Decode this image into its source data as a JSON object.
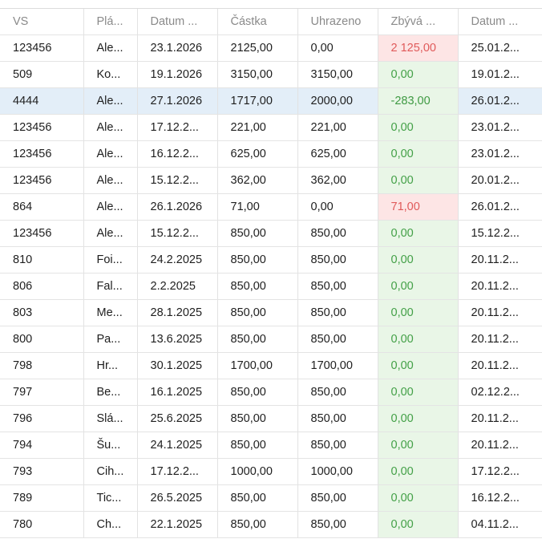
{
  "columns": [
    "VS",
    "Plá...",
    "Datum ...",
    "Částka",
    "Uhrazeno",
    "Zbývá ...",
    "Datum ..."
  ],
  "rows": [
    {
      "vs": "123456",
      "pla": "Ale...",
      "datum": "23.1.2026",
      "castka": "2125,00",
      "uhrazeno": "0,00",
      "zbyva": "2 125,00",
      "zbyva_status": "due",
      "datum2": "25.01.2..."
    },
    {
      "vs": "509",
      "pla": "Ko...",
      "datum": "19.1.2026",
      "castka": "3150,00",
      "uhrazeno": "3150,00",
      "zbyva": "0,00",
      "zbyva_status": "paid",
      "datum2": "19.01.2..."
    },
    {
      "vs": "4444",
      "pla": "Ale...",
      "datum": "27.1.2026",
      "castka": "1717,00",
      "uhrazeno": "2000,00",
      "zbyva": "-283,00",
      "zbyva_status": "overpaid",
      "datum2": "26.01.2...",
      "selected": true
    },
    {
      "vs": "123456",
      "pla": "Ale...",
      "datum": "17.12.2...",
      "castka": "221,00",
      "uhrazeno": "221,00",
      "zbyva": "0,00",
      "zbyva_status": "paid",
      "datum2": "23.01.2..."
    },
    {
      "vs": "123456",
      "pla": "Ale...",
      "datum": "16.12.2...",
      "castka": "625,00",
      "uhrazeno": "625,00",
      "zbyva": "0,00",
      "zbyva_status": "paid",
      "datum2": "23.01.2..."
    },
    {
      "vs": "123456",
      "pla": "Ale...",
      "datum": "15.12.2...",
      "castka": "362,00",
      "uhrazeno": "362,00",
      "zbyva": "0,00",
      "zbyva_status": "paid",
      "datum2": "20.01.2..."
    },
    {
      "vs": "864",
      "pla": "Ale...",
      "datum": "26.1.2026",
      "castka": "71,00",
      "uhrazeno": "0,00",
      "zbyva": "71,00",
      "zbyva_status": "due",
      "datum2": "26.01.2..."
    },
    {
      "vs": "123456",
      "pla": "Ale...",
      "datum": "15.12.2...",
      "castka": "850,00",
      "uhrazeno": "850,00",
      "zbyva": "0,00",
      "zbyva_status": "paid",
      "datum2": "15.12.2..."
    },
    {
      "vs": "810",
      "pla": "Foi...",
      "datum": "24.2.2025",
      "castka": "850,00",
      "uhrazeno": "850,00",
      "zbyva": "0,00",
      "zbyva_status": "paid",
      "datum2": "20.11.2..."
    },
    {
      "vs": "806",
      "pla": "Fal...",
      "datum": "2.2.2025",
      "castka": "850,00",
      "uhrazeno": "850,00",
      "zbyva": "0,00",
      "zbyva_status": "paid",
      "datum2": "20.11.2..."
    },
    {
      "vs": "803",
      "pla": "Me...",
      "datum": "28.1.2025",
      "castka": "850,00",
      "uhrazeno": "850,00",
      "zbyva": "0,00",
      "zbyva_status": "paid",
      "datum2": "20.11.2..."
    },
    {
      "vs": "800",
      "pla": "Pa...",
      "datum": "13.6.2025",
      "castka": "850,00",
      "uhrazeno": "850,00",
      "zbyva": "0,00",
      "zbyva_status": "paid",
      "datum2": "20.11.2..."
    },
    {
      "vs": "798",
      "pla": "Hr...",
      "datum": "30.1.2025",
      "castka": "1700,00",
      "uhrazeno": "1700,00",
      "zbyva": "0,00",
      "zbyva_status": "paid",
      "datum2": "20.11.2..."
    },
    {
      "vs": "797",
      "pla": "Be...",
      "datum": "16.1.2025",
      "castka": "850,00",
      "uhrazeno": "850,00",
      "zbyva": "0,00",
      "zbyva_status": "paid",
      "datum2": "02.12.2..."
    },
    {
      "vs": "796",
      "pla": "Slá...",
      "datum": "25.6.2025",
      "castka": "850,00",
      "uhrazeno": "850,00",
      "zbyva": "0,00",
      "zbyva_status": "paid",
      "datum2": "20.11.2..."
    },
    {
      "vs": "794",
      "pla": "Šu...",
      "datum": "24.1.2025",
      "castka": "850,00",
      "uhrazeno": "850,00",
      "zbyva": "0,00",
      "zbyva_status": "paid",
      "datum2": "20.11.2..."
    },
    {
      "vs": "793",
      "pla": "Cih...",
      "datum": "17.12.2...",
      "castka": "1000,00",
      "uhrazeno": "1000,00",
      "zbyva": "0,00",
      "zbyva_status": "paid",
      "datum2": "17.12.2..."
    },
    {
      "vs": "789",
      "pla": "Tic...",
      "datum": "26.5.2025",
      "castka": "850,00",
      "uhrazeno": "850,00",
      "zbyva": "0,00",
      "zbyva_status": "paid",
      "datum2": "16.12.2..."
    },
    {
      "vs": "780",
      "pla": "Ch...",
      "datum": "22.1.2025",
      "castka": "850,00",
      "uhrazeno": "850,00",
      "zbyva": "0,00",
      "zbyva_status": "paid",
      "datum2": "04.11.2..."
    }
  ],
  "colors": {
    "due_text": "#e05a5a",
    "due_bg": "#fde5e5",
    "paid_text": "#43a047",
    "paid_bg": "#e9f6e7",
    "selected_bg": "#e3eef8"
  }
}
